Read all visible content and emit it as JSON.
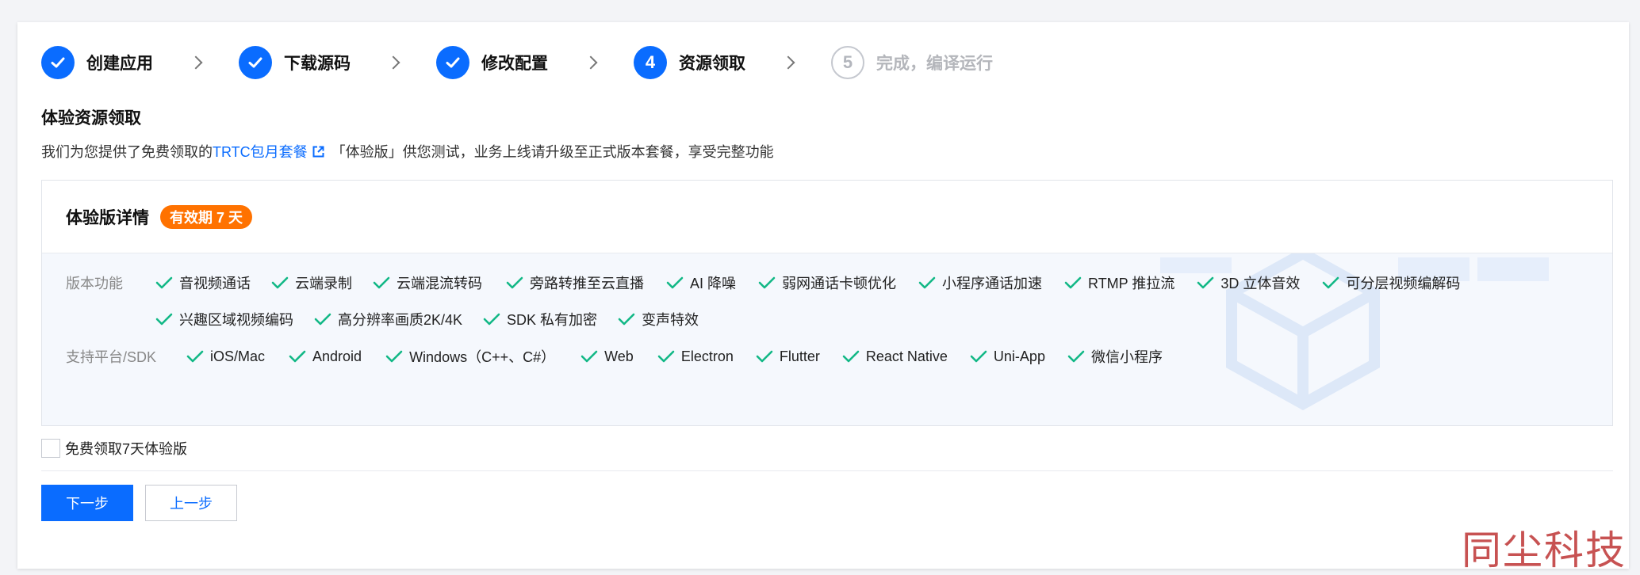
{
  "steps": [
    {
      "num": "",
      "label": "创建应用",
      "state": "done"
    },
    {
      "num": "",
      "label": "下载源码",
      "state": "done"
    },
    {
      "num": "",
      "label": "修改配置",
      "state": "done"
    },
    {
      "num": "4",
      "label": "资源领取",
      "state": "current"
    },
    {
      "num": "5",
      "label": "完成，编译运行",
      "state": "pending"
    }
  ],
  "section": {
    "title": "体验资源领取",
    "desc_prefix": "我们为您提供了免费领取的",
    "desc_link": "TRTC包月套餐",
    "desc_suffix": "「体验版」供您测试，业务上线请升级至正式版本套餐，享受完整功能"
  },
  "panel": {
    "title": "体验版详情",
    "badge": "有效期 7 天",
    "features_label": "版本功能",
    "features_row1": [
      "音视频通话",
      "云端录制",
      "云端混流转码",
      "旁路转推至云直播",
      "AI 降噪",
      "弱网通话卡顿优化",
      "小程序通话加速",
      "RTMP 推拉流",
      "3D 立体音效",
      "可分层视频编解码"
    ],
    "features_row2": [
      "兴趣区域视频编码",
      "高分辨率画质2K/4K",
      "SDK 私有加密",
      "变声特效"
    ],
    "platform_label": "支持平台/SDK",
    "platforms": [
      "iOS/Mac",
      "Android",
      "Windows（C++、C#）",
      "Web",
      "Electron",
      "Flutter",
      "React Native",
      "Uni-App",
      "微信小程序"
    ]
  },
  "agree_label": "免费领取7天体验版",
  "buttons": {
    "next": "下一步",
    "prev": "上一步"
  },
  "brand": "同尘科技",
  "colors": {
    "primary": "#0a6cff",
    "badge": "#ff7200",
    "check": "#12b886"
  }
}
